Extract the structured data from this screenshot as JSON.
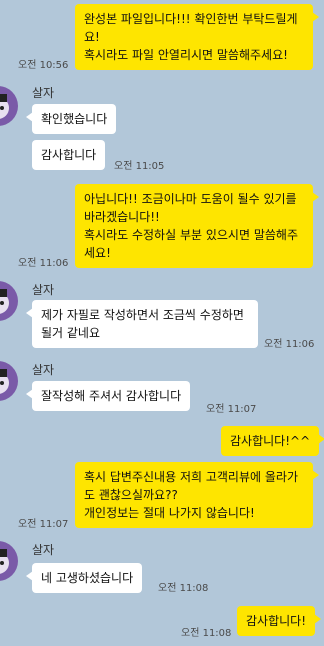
{
  "sender_name": "살자",
  "messages": [
    {
      "id": "m1",
      "side": "mine",
      "text": "완성본 파일입니다!!! 확인한번 부탁드릴게요!\n혹시라도 파일 안열리시면 말씀해주세요!",
      "time": "오전 10:56"
    },
    {
      "id": "m2",
      "side": "theirs",
      "text": "확인했습니다",
      "time": ""
    },
    {
      "id": "m3",
      "side": "theirs",
      "text": "감사합니다",
      "time": "오전 11:05"
    },
    {
      "id": "m4",
      "side": "mine",
      "text": "아닙니다!! 조금이나마 도움이 될수 있기를 바라겠습니다!!\n혹시라도 수정하실 부분 있으시면 말씀해주세요!",
      "time": "오전 11:06"
    },
    {
      "id": "m5",
      "side": "theirs",
      "text": "제가 자필로 작성하면서 조금씩 수정하면 될거 같네요",
      "time": "오전 11:06"
    },
    {
      "id": "m6",
      "side": "theirs",
      "text": "잘작성해 주셔서 감사합니다",
      "time": "오전 11:07"
    },
    {
      "id": "m7",
      "side": "mine",
      "text": "감사합니다!^^",
      "time": ""
    },
    {
      "id": "m8",
      "side": "mine",
      "text": "혹시 답변주신내용 저희 고객리뷰에 올라가도 괜찮으실까요??\n개인정보는 절대 나가지 않습니다!",
      "time": "오전 11:07"
    },
    {
      "id": "m9",
      "side": "theirs",
      "text": "네 고생하셨습니다",
      "time": "오전 11:08"
    },
    {
      "id": "m10",
      "side": "mine",
      "text": "감사합니다!",
      "time": "오전 11:08"
    }
  ]
}
